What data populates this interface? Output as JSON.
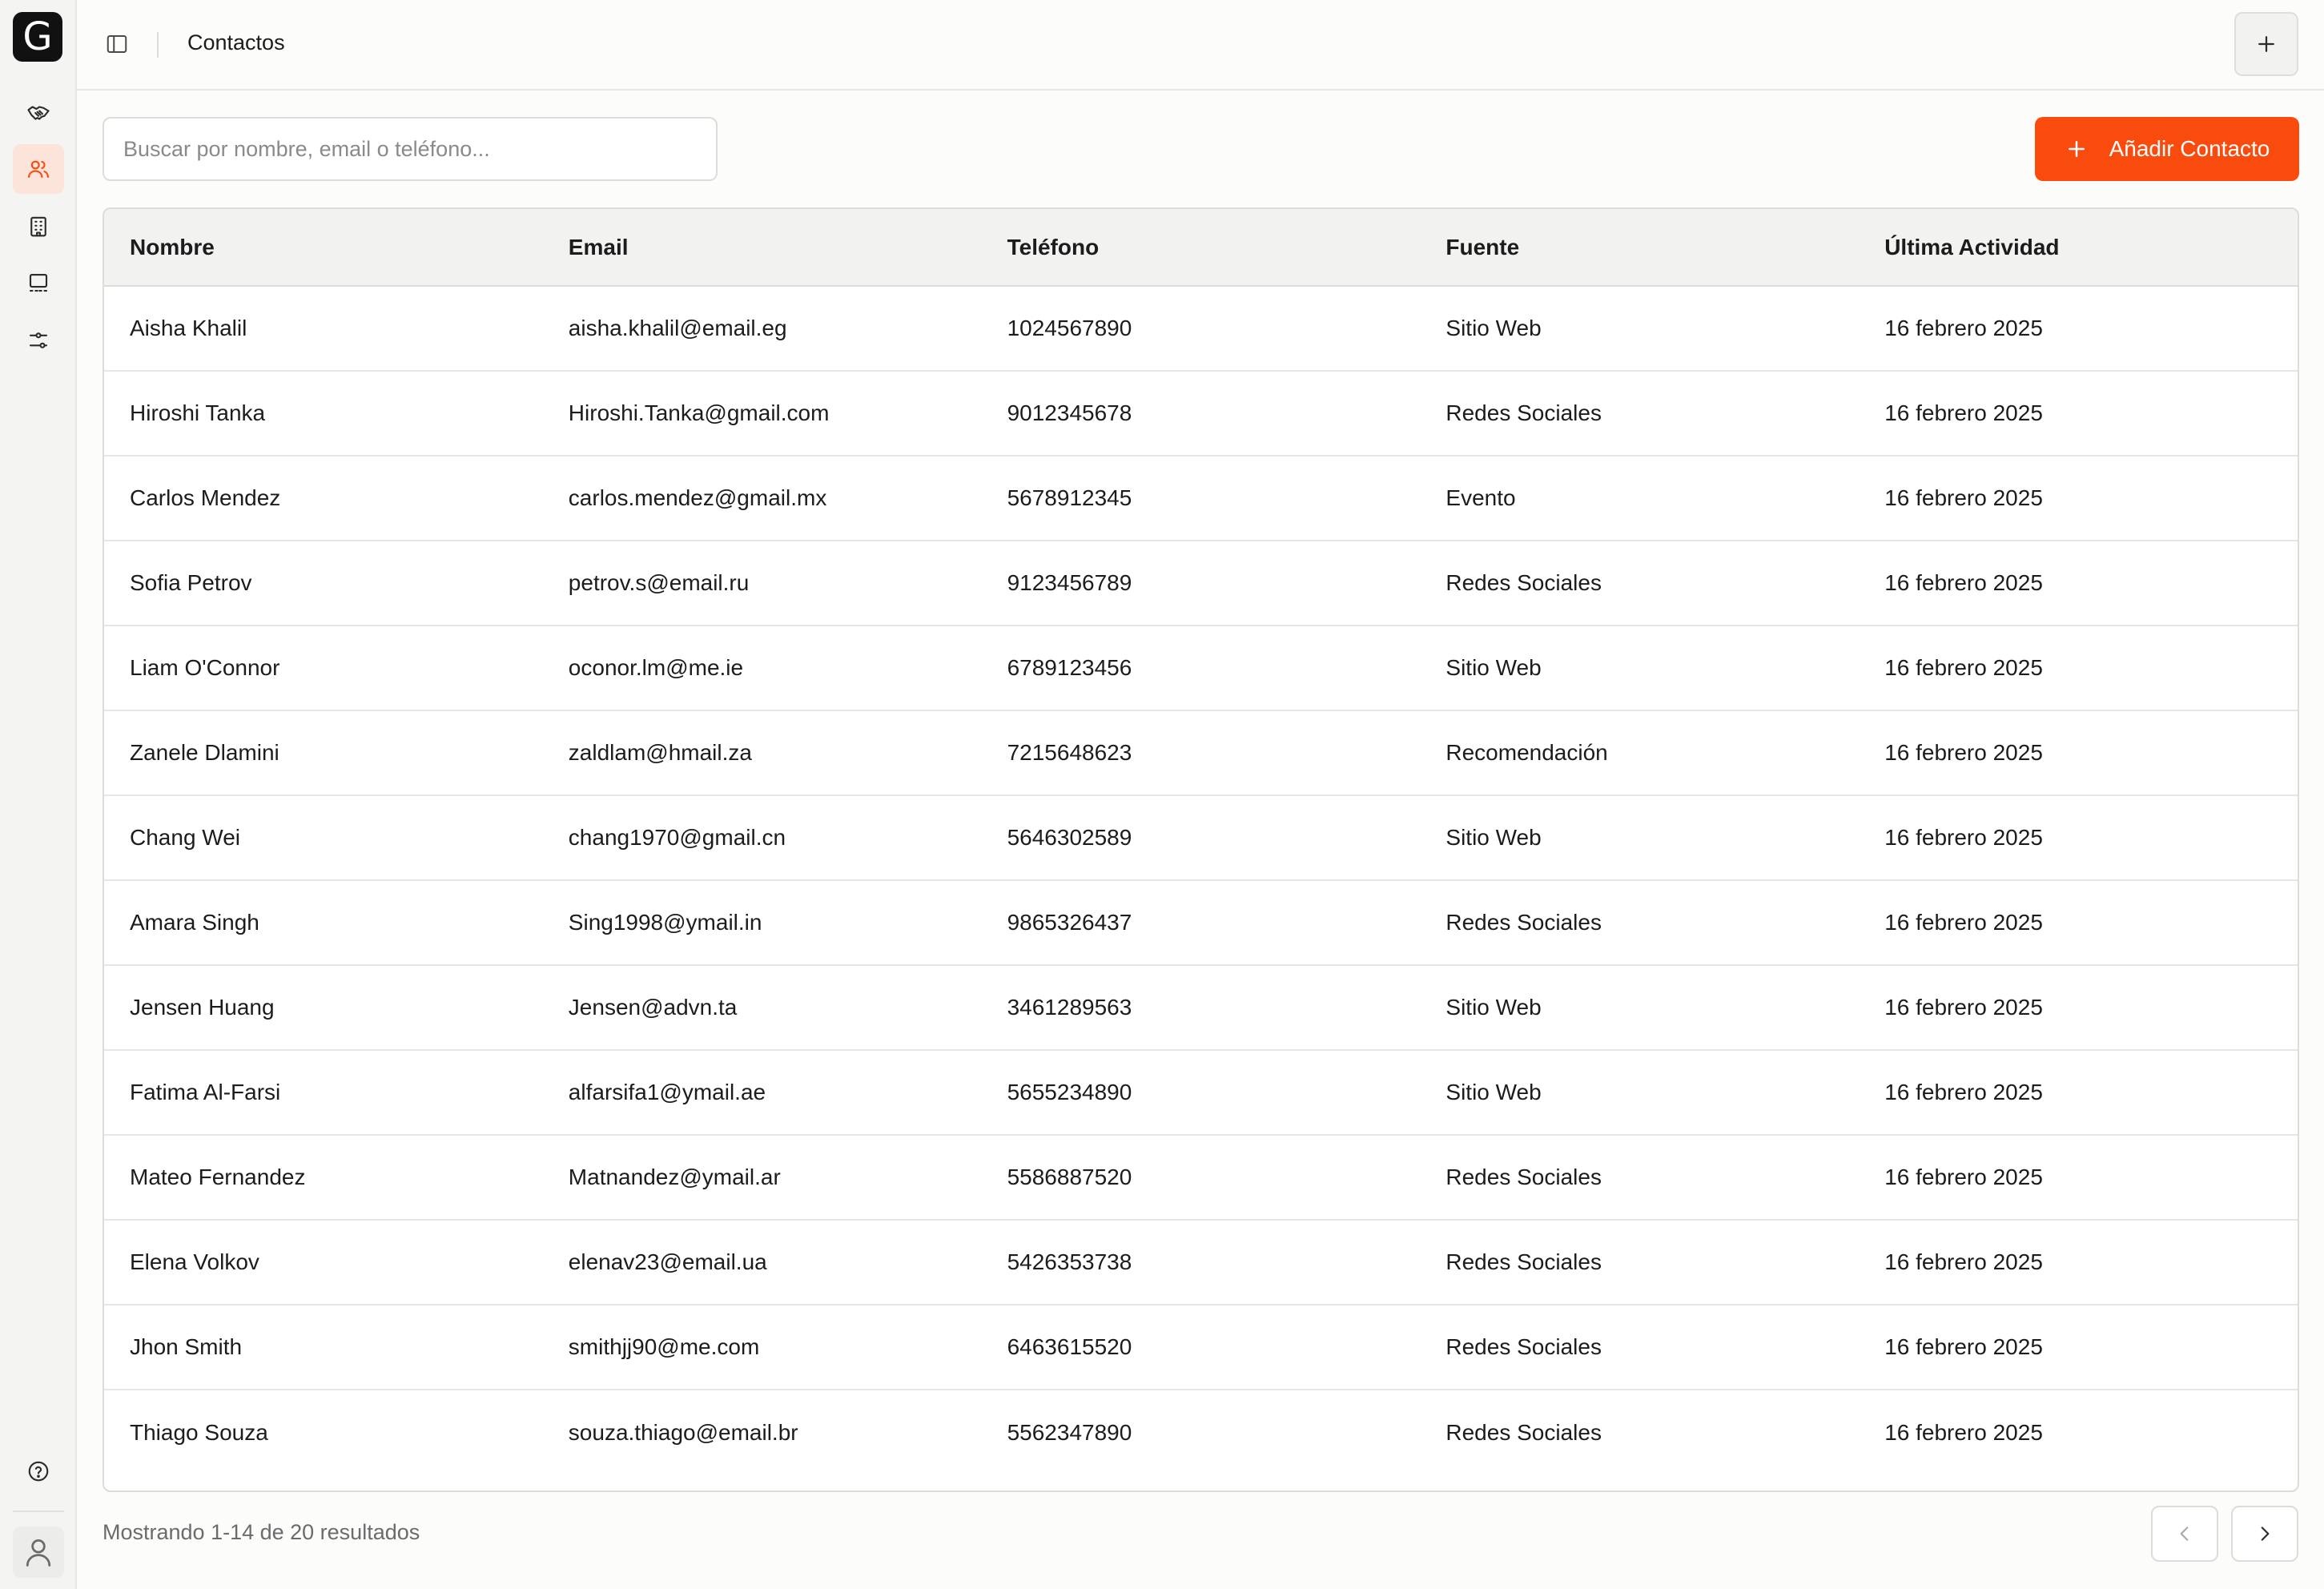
{
  "app": {
    "logo_letter": "G"
  },
  "sidebar": {
    "items": [
      {
        "name": "handshake-icon",
        "active": false
      },
      {
        "name": "users-icon",
        "active": true
      },
      {
        "name": "building-icon",
        "active": false
      },
      {
        "name": "presentation-icon",
        "active": false
      },
      {
        "name": "sliders-icon",
        "active": false
      }
    ],
    "bottom": [
      "help-icon",
      "user-icon"
    ]
  },
  "header": {
    "title": "Contactos"
  },
  "toolbar": {
    "search_placeholder": "Buscar por nombre, email o teléfono...",
    "search_value": "",
    "add_label": "Añadir Contacto"
  },
  "table": {
    "columns": [
      "Nombre",
      "Email",
      "Teléfono",
      "Fuente",
      "Última Actividad"
    ],
    "rows": [
      [
        "Aisha Khalil",
        "aisha.khalil@email.eg",
        "1024567890",
        "Sitio Web",
        "16 febrero 2025"
      ],
      [
        "Hiroshi Tanka",
        "Hiroshi.Tanka@gmail.com",
        "9012345678",
        "Redes Sociales",
        "16 febrero 2025"
      ],
      [
        "Carlos Mendez",
        "carlos.mendez@gmail.mx",
        "5678912345",
        "Evento",
        "16 febrero 2025"
      ],
      [
        "Sofia Petrov",
        "petrov.s@email.ru",
        "9123456789",
        "Redes Sociales",
        "16 febrero 2025"
      ],
      [
        "Liam O'Connor",
        "oconor.lm@me.ie",
        "6789123456",
        "Sitio Web",
        "16 febrero 2025"
      ],
      [
        "Zanele Dlamini",
        "zaldlam@hmail.za",
        "7215648623",
        "Recomendación",
        "16 febrero 2025"
      ],
      [
        "Chang Wei",
        "chang1970@gmail.cn",
        "5646302589",
        "Sitio Web",
        "16 febrero 2025"
      ],
      [
        "Amara Singh",
        "Sing1998@ymail.in",
        "9865326437",
        "Redes Sociales",
        "16 febrero 2025"
      ],
      [
        "Jensen Huang",
        "Jensen@advn.ta",
        "3461289563",
        "Sitio Web",
        "16 febrero 2025"
      ],
      [
        "Fatima Al-Farsi",
        "alfarsifa1@ymail.ae",
        "5655234890",
        "Sitio Web",
        "16 febrero 2025"
      ],
      [
        "Mateo Fernandez",
        "Matnandez@ymail.ar",
        "5586887520",
        "Redes Sociales",
        "16 febrero 2025"
      ],
      [
        "Elena Volkov",
        "elenav23@email.ua",
        "5426353738",
        "Redes Sociales",
        "16 febrero 2025"
      ],
      [
        "Jhon Smith",
        "smithjj90@me.com",
        "6463615520",
        "Redes Sociales",
        "16 febrero 2025"
      ],
      [
        "Thiago Souza",
        "souza.thiago@email.br",
        "5562347890",
        "Redes Sociales",
        "16 febrero 2025"
      ]
    ]
  },
  "footer": {
    "results_text": "Mostrando 1-14 de 20 resultados"
  },
  "colors": {
    "accent": "#fa4b0f",
    "accent_soft": "#fde4da",
    "sidebar_bg": "#f4f4f2"
  }
}
